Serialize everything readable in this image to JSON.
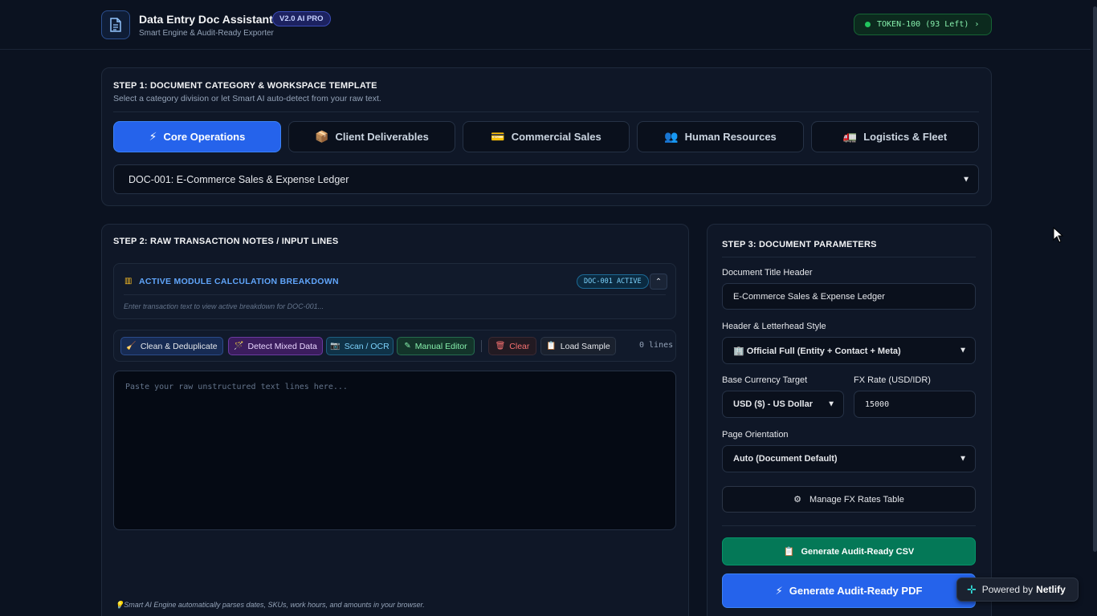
{
  "header": {
    "title": "Data Entry Doc Assistant",
    "version_badge": "V2.0 AI PRO",
    "subtitle": "Smart Engine & Audit-Ready Exporter",
    "token_label": "TOKEN-100 (93 Left)",
    "token_chevron": "›"
  },
  "step1": {
    "title": "STEP 1: DOCUMENT CATEGORY & WORKSPACE TEMPLATE",
    "description": "Select a category division or let Smart AI auto-detect from your raw text.",
    "tabs": [
      {
        "label": "Core Operations",
        "icon": "⚡",
        "active": true
      },
      {
        "label": "Client Deliverables",
        "icon": "📦",
        "active": false
      },
      {
        "label": "Commercial Sales",
        "icon": "💳",
        "active": false
      },
      {
        "label": "Human Resources",
        "icon": "👥",
        "active": false
      },
      {
        "label": "Logistics & Fleet",
        "icon": "🚛",
        "active": false
      }
    ],
    "template_selected": "DOC-001: E-Commerce Sales & Expense Ledger"
  },
  "step2": {
    "title": "STEP 2: RAW TRANSACTION NOTES / INPUT LINES",
    "breakdown_title": "ACTIVE MODULE CALCULATION BREAKDOWN",
    "active_badge": "DOC-001 ACTIVE",
    "breakdown_hint": "Enter transaction text to view active breakdown for DOC-001...",
    "toolbar": {
      "clean": "Clean & Deduplicate",
      "detect": "Detect Mixed Data",
      "scan": "Scan / OCR",
      "manual": "Manual Editor",
      "clear": "Clear",
      "load": "Load Sample",
      "line_count": "0 lines"
    },
    "textarea_placeholder": "Paste your raw unstructured text lines here...",
    "footer_hint": "💡Smart AI Engine automatically parses dates, SKUs, work hours, and amounts in your browser."
  },
  "step3": {
    "title": "STEP 3: DOCUMENT PARAMETERS",
    "doc_title_label": "Document Title Header",
    "doc_title_value": "E-Commerce Sales & Expense Ledger",
    "letterhead_label": "Header & Letterhead Style",
    "letterhead_value": "🏢 Official Full (Entity + Contact + Meta)",
    "currency_label": "Base Currency Target",
    "currency_value": "USD ($) - US Dollar",
    "fx_label": "FX Rate (USD/IDR)",
    "fx_value": "15000",
    "orientation_label": "Page Orientation",
    "orientation_value": "Auto (Document Default)",
    "fx_table_button": "Manage FX Rates Table",
    "csv_button": "Generate Audit-Ready CSV",
    "pdf_button": "Generate Audit-Ready PDF"
  },
  "netlify": {
    "prefix": "Powered by",
    "brand": "Netlify"
  },
  "colors": {
    "background": "#0b1220",
    "primary": "#2563eb",
    "success": "#047857",
    "token_green": "#22c55e"
  }
}
